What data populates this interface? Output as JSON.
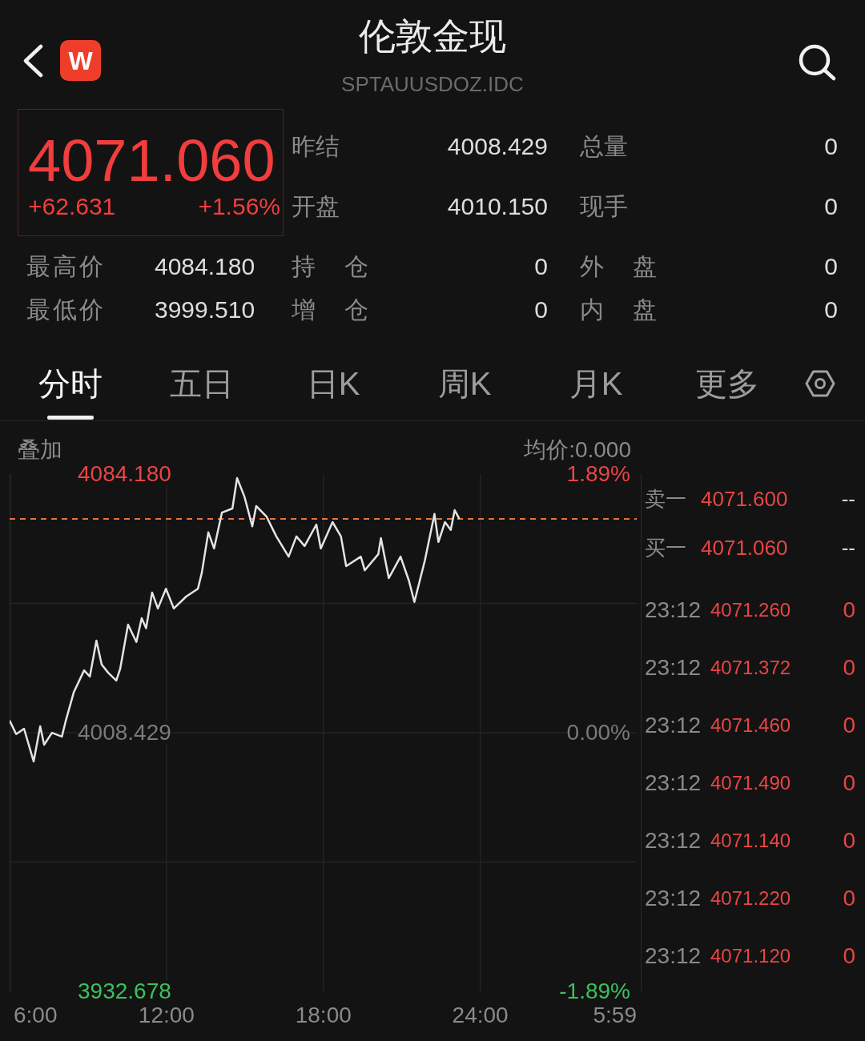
{
  "header": {
    "logo_text": "W",
    "title": "伦敦金现",
    "subtitle": "SPTAUUSDOZ.IDC"
  },
  "quote": {
    "price": "4071.060",
    "change": "+62.631",
    "change_percent": "+1.56%",
    "rising": true
  },
  "stats_top": [
    [
      {
        "label": "昨结",
        "value": "4008.429"
      },
      {
        "label": "总量",
        "value": "0"
      }
    ],
    [
      {
        "label": "开盘",
        "value": "4010.150"
      },
      {
        "label": "现手",
        "value": "0"
      }
    ]
  ],
  "stats_bottom": [
    [
      {
        "label": "最高价",
        "value": "4084.180"
      },
      {
        "label": "持 仓",
        "value": "0"
      },
      {
        "label": "外 盘",
        "value": "0"
      }
    ],
    [
      {
        "label": "最低价",
        "value": "3999.510"
      },
      {
        "label": "增 仓",
        "value": "0"
      },
      {
        "label": "内 盘",
        "value": "0"
      }
    ]
  ],
  "tabs": [
    {
      "label": "分时",
      "selected": true
    },
    {
      "label": "五日",
      "selected": false
    },
    {
      "label": "日K",
      "selected": false
    },
    {
      "label": "周K",
      "selected": false
    },
    {
      "label": "月K",
      "selected": false
    },
    {
      "label": "更多",
      "selected": false
    }
  ],
  "chart": {
    "overlay_label": "叠加",
    "average_price": "均价:0.000",
    "right_axis_labels": [
      "1.89%",
      "0.00%",
      "-1.89%"
    ],
    "axis_end_label": "5:59",
    "chart_data": {
      "type": "line",
      "grid": true,
      "x": [
        6.0,
        6.25,
        6.55,
        6.92,
        7.17,
        7.32,
        7.62,
        8.0,
        8.15,
        8.45,
        8.85,
        9.07,
        9.32,
        9.52,
        9.77,
        10.08,
        10.23,
        10.53,
        10.85,
        11.05,
        11.22,
        11.45,
        11.67,
        11.98,
        12.28,
        12.75,
        13.2,
        13.35,
        13.6,
        13.82,
        14.12,
        14.52,
        14.7,
        14.98,
        15.28,
        15.43,
        15.82,
        16.2,
        16.67,
        16.97,
        17.28,
        17.73,
        17.9,
        18.35,
        18.67,
        18.87,
        19.43,
        19.58,
        20.1,
        20.2,
        20.5,
        20.95,
        21.27,
        21.48,
        21.88,
        22.25,
        22.4,
        22.65,
        22.87,
        23.02,
        23.2
      ],
      "series": [
        {
          "color": "#e4e4e4",
          "values": [
            4012.0,
            4008.0,
            4009.6,
            4000.0,
            4010.3,
            4004.9,
            4008.4,
            4007.3,
            4012.0,
            4020.2,
            4026.7,
            4024.9,
            4035.4,
            4028.4,
            4026.0,
            4023.7,
            4027.2,
            4040.1,
            4035.0,
            4042.0,
            4039.0,
            4049.5,
            4044.8,
            4050.6,
            4044.8,
            4048.3,
            4050.6,
            4055.3,
            4067.1,
            4062.4,
            4072.9,
            4074.1,
            4083.0,
            4077.6,
            4068.9,
            4074.8,
            4071.8,
            4065.9,
            4060.0,
            4065.9,
            4063.1,
            4069.4,
            4062.4,
            4070.1,
            4065.9,
            4057.2,
            4060.0,
            4056.0,
            4060.7,
            4065.4,
            4053.7,
            4060.0,
            4053.0,
            4046.7,
            4058.9,
            4072.5,
            4064.3,
            4070.1,
            4067.8,
            4073.6,
            4071.1
          ]
        }
      ],
      "xlim": [
        6,
        29.983
      ],
      "ylim": [
        3932.678,
        4084.18
      ],
      "xticks": [
        {
          "value": 6,
          "label": "6:00"
        },
        {
          "value": 12,
          "label": "12:00"
        },
        {
          "value": 18,
          "label": "18:00"
        },
        {
          "value": 24,
          "label": "24:00"
        }
      ],
      "yticks": [
        {
          "value": 4084.18,
          "label": "4084.180"
        },
        {
          "value": 4008.429,
          "label": "4008.429"
        },
        {
          "value": 3932.678,
          "label": "3932.678"
        }
      ],
      "ref_lines": [
        {
          "axis": "y",
          "value": 4071.06,
          "color": "#e8743c"
        }
      ]
    }
  },
  "order_book": [
    {
      "label": "卖一",
      "price": "4071.600",
      "volume": "--"
    },
    {
      "label": "买一",
      "price": "4071.060",
      "volume": "--"
    }
  ],
  "trades": [
    {
      "time": "23:12",
      "price": "4071.260",
      "volume": "0"
    },
    {
      "time": "23:12",
      "price": "4071.372",
      "volume": "0"
    },
    {
      "time": "23:12",
      "price": "4071.460",
      "volume": "0"
    },
    {
      "time": "23:12",
      "price": "4071.490",
      "volume": "0"
    },
    {
      "time": "23:12",
      "price": "4071.140",
      "volume": "0"
    },
    {
      "time": "23:12",
      "price": "4071.220",
      "volume": "0"
    },
    {
      "time": "23:12",
      "price": "4071.120",
      "volume": "0"
    }
  ]
}
